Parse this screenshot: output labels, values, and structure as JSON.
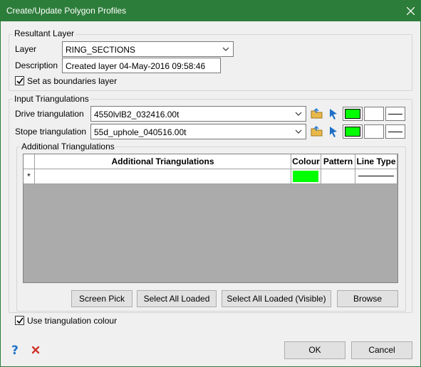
{
  "window": {
    "title": "Create/Update Polygon Profiles"
  },
  "resultant_layer": {
    "group_label": "Resultant Layer",
    "layer_label": "Layer",
    "layer_value": "RING_SECTIONS",
    "description_label": "Description",
    "description_value": "Created layer 04-May-2016 09:58:46",
    "boundaries_label": "Set as boundaries layer",
    "boundaries_checked": true
  },
  "input_triangulations": {
    "group_label": "Input Triangulations",
    "drive_label": "Drive triangulation",
    "drive_value": "4550lvlB2_032416.00t",
    "stope_label": "Stope triangulation",
    "stope_value": "55d_uphole_040516.00t",
    "colour": "#00ff00"
  },
  "additional_triangulations": {
    "group_label": "Additional Triangulations",
    "columns": [
      "Additional Triangulations",
      "Colour",
      "Pattern",
      "Line Type"
    ],
    "new_row_marker": "*",
    "row_colour": "#00ff00",
    "buttons": {
      "screen_pick": "Screen Pick",
      "select_all_loaded": "Select All Loaded",
      "select_all_loaded_visible": "Select All Loaded (Visible)",
      "browse": "Browse"
    }
  },
  "options": {
    "use_triangulation_colour_label": "Use triangulation colour",
    "use_triangulation_colour_checked": true
  },
  "footer": {
    "help_icon": "help-icon",
    "cancel_icon": "red-x-icon",
    "ok_label": "OK",
    "cancel_label": "Cancel"
  }
}
